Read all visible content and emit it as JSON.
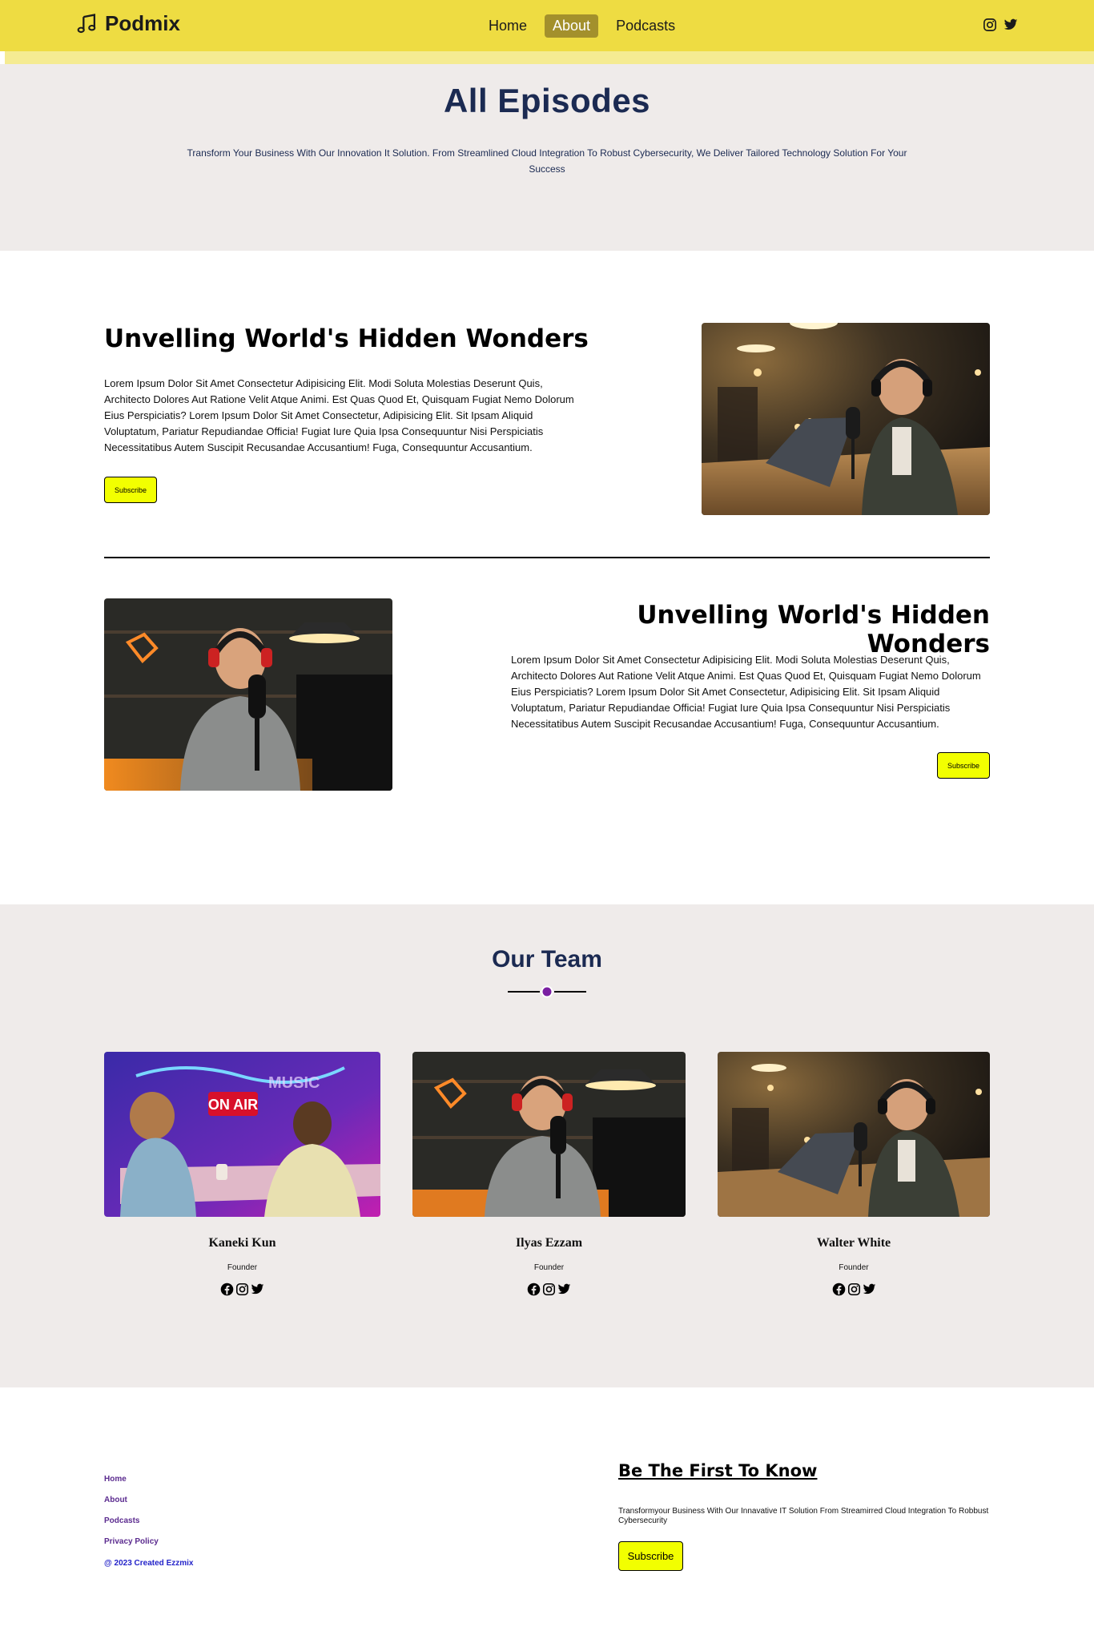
{
  "navbar": {
    "brand": "Podmix",
    "links": [
      {
        "label": "Home",
        "active": false
      },
      {
        "label": "About",
        "active": true
      },
      {
        "label": "Podcasts",
        "active": false
      }
    ],
    "social_icons": [
      "instagram-icon",
      "twitter-icon"
    ],
    "colors": {
      "bar": "#eedc42",
      "active_bg": "#a3902c"
    }
  },
  "hero": {
    "title": "All Episodes",
    "subtitle": "Transform Your Business With Our Innovation It Solution. From Streamlined Cloud Integration To Robust Cybersecurity, We Deliver Tailored Technology Solution For Your Success"
  },
  "episodes": [
    {
      "title": "Unvelling World's Hidden Wonders",
      "text": "Lorem Ipsum Dolor Sit Amet Consectetur Adipisicing Elit. Modi Soluta Molestias Deserunt Quis, Architecto Dolores Aut Ratione Velit Atque Animi. Est Quas Quod Et, Quisquam Fugiat Nemo Dolorum Eius Perspiciatis? Lorem Ipsum Dolor Sit Amet Consectetur, Adipisicing Elit. Sit Ipsam Aliquid Voluptatum, Pariatur Repudiandae Officia! Fugiat Iure Quia Ipsa Consequuntur Nisi Perspiciatis Necessitatibus Autem Suscipit Recusandae Accusantium! Fuga, Consequuntur Accusantium.",
      "button": "Subscribe"
    },
    {
      "title": "Unvelling World's Hidden Wonders",
      "text": "Lorem Ipsum Dolor Sit Amet Consectetur Adipisicing Elit. Modi Soluta Molestias Deserunt Quis, Architecto Dolores Aut Ratione Velit Atque Animi. Est Quas Quod Et, Quisquam Fugiat Nemo Dolorum Eius Perspiciatis? Lorem Ipsum Dolor Sit Amet Consectetur, Adipisicing Elit. Sit Ipsam Aliquid Voluptatum, Pariatur Repudiandae Officia! Fugiat Iure Quia Ipsa Consequuntur Nisi Perspiciatis Necessitatibus Autem Suscipit Recusandae Accusantium! Fuga, Consequuntur Accusantium.",
      "button": "Subscribe"
    }
  ],
  "team": {
    "title": "Our Team",
    "members": [
      {
        "name": "Kaneki Kun",
        "role": "Founder",
        "photo_text": "ON AIR"
      },
      {
        "name": "Ilyas Ezzam",
        "role": "Founder"
      },
      {
        "name": "Walter White",
        "role": "Founder"
      }
    ],
    "social_icons": [
      "facebook-icon",
      "instagram-icon",
      "twitter-icon"
    ],
    "accent_dot": "#7a1fa2"
  },
  "footer": {
    "links": [
      "Home",
      "About",
      "Podcasts",
      "Privacy Policy"
    ],
    "copyright": "@ 2023 Created Ezzmix",
    "newsletter_title": "Be The First To Know",
    "newsletter_text": "Transformyour Business With Our Innavative IT Solution From Streamirred Cloud Integration To Robbust Cybersecurity",
    "button": "Subscribe"
  }
}
